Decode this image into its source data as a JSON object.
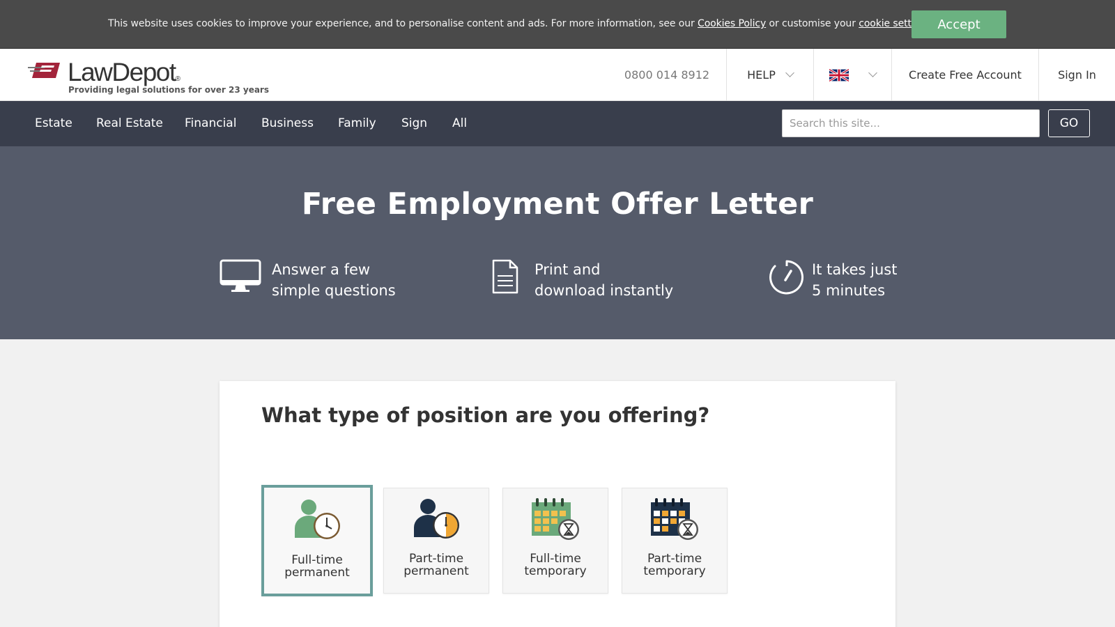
{
  "cookie": {
    "text_before": "This website uses cookies to improve your experience, and to personalise content and ads. For more information, see our ",
    "policy_link": "Cookies Policy",
    "text_middle": " or customise your ",
    "settings_link": "cookie settings",
    "text_after": ".",
    "accept_label": "Accept"
  },
  "header": {
    "logo_text_1": "Law",
    "logo_text_2": "Depot",
    "logo_reg": "®",
    "tagline": "Providing legal solutions for over 23 years",
    "phone": "0800 014 8912",
    "help_label": "HELP",
    "create_account_label": "Create Free Account",
    "sign_in_label": "Sign In"
  },
  "nav": {
    "items": [
      "Estate",
      "Real Estate",
      "Financial",
      "Business",
      "Family",
      "Sign",
      "All"
    ],
    "search_placeholder": "Search this site...",
    "go_label": "GO"
  },
  "hero": {
    "title": "Free Employment Offer Letter",
    "features": [
      {
        "line1": "Answer a few",
        "line2": "simple questions",
        "icon": "monitor-icon"
      },
      {
        "line1": "Print and",
        "line2": "download instantly",
        "icon": "document-icon"
      },
      {
        "line1": "It takes just",
        "line2": "5 minutes",
        "icon": "stopwatch-icon"
      }
    ]
  },
  "question": {
    "text": "What type of position are you offering?",
    "options": [
      {
        "line1": "Full-time",
        "line2": "permanent",
        "selected": true,
        "icon": "person-clock-green-icon"
      },
      {
        "line1": "Part-time",
        "line2": "permanent",
        "selected": false,
        "icon": "person-clock-navy-icon"
      },
      {
        "line1": "Full-time",
        "line2": "temporary",
        "selected": false,
        "icon": "calendar-hourglass-green-icon"
      },
      {
        "line1": "Part-time",
        "line2": "temporary",
        "selected": false,
        "icon": "calendar-hourglass-navy-icon"
      }
    ]
  },
  "colors": {
    "accept_green": "#6bb281",
    "nav_bg": "#393e4c",
    "hero_bg": "#555b6a",
    "selected_border": "#6a9e9b",
    "logo_red": "#a3243b"
  }
}
